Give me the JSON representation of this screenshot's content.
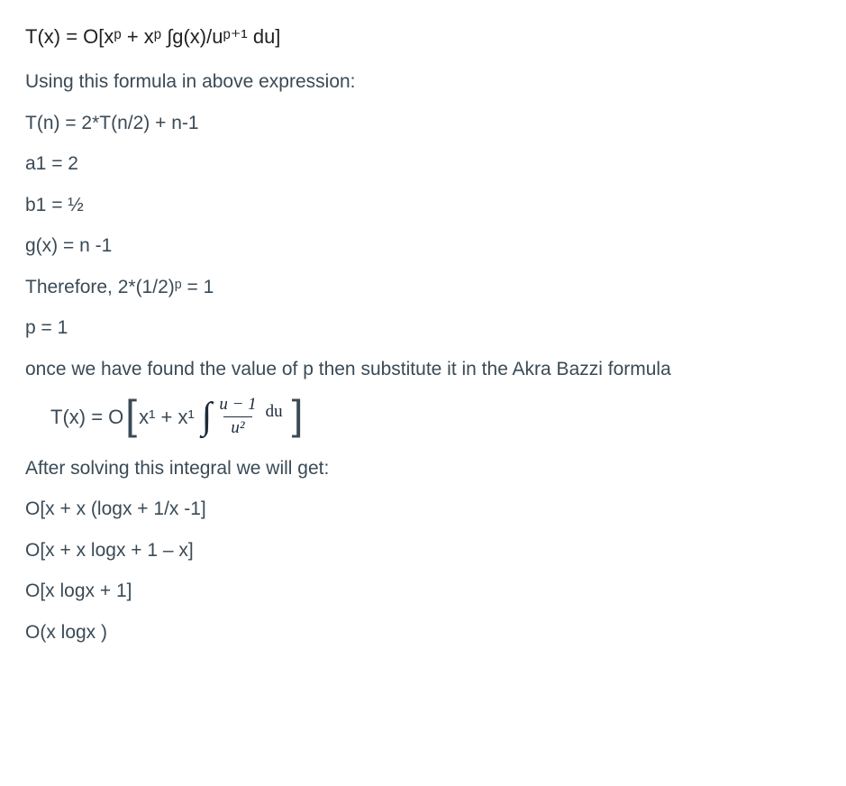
{
  "formula_top": "T(x) = O[xᵖ + xᵖ ∫g(x)/uᵖ⁺¹ du]",
  "intro": "Using this formula in above expression:",
  "step1": "T(n) = 2*T(n/2) + n-1",
  "step2": "a1 = 2",
  "step3": "b1 = ½",
  "step4": "g(x) = n -1",
  "step5": "Therefore, 2*(1/2)ᵖ = 1",
  "step6": "p = 1",
  "step7": "once we have found the value of p then substitute it in the Akra Bazzi formula",
  "int_lead": "T(x) = O",
  "int_middle": "x¹ + x¹",
  "int_num": "u − 1",
  "int_den": "u²",
  "int_du": "du",
  "after": "After solving this integral we will get:",
  "r1": "O[x + x (logx + 1/x -1]",
  "r2": "O[x + x logx + 1 – x]",
  "r3": "O[x logx + 1]",
  "r4": "O(x logx )"
}
